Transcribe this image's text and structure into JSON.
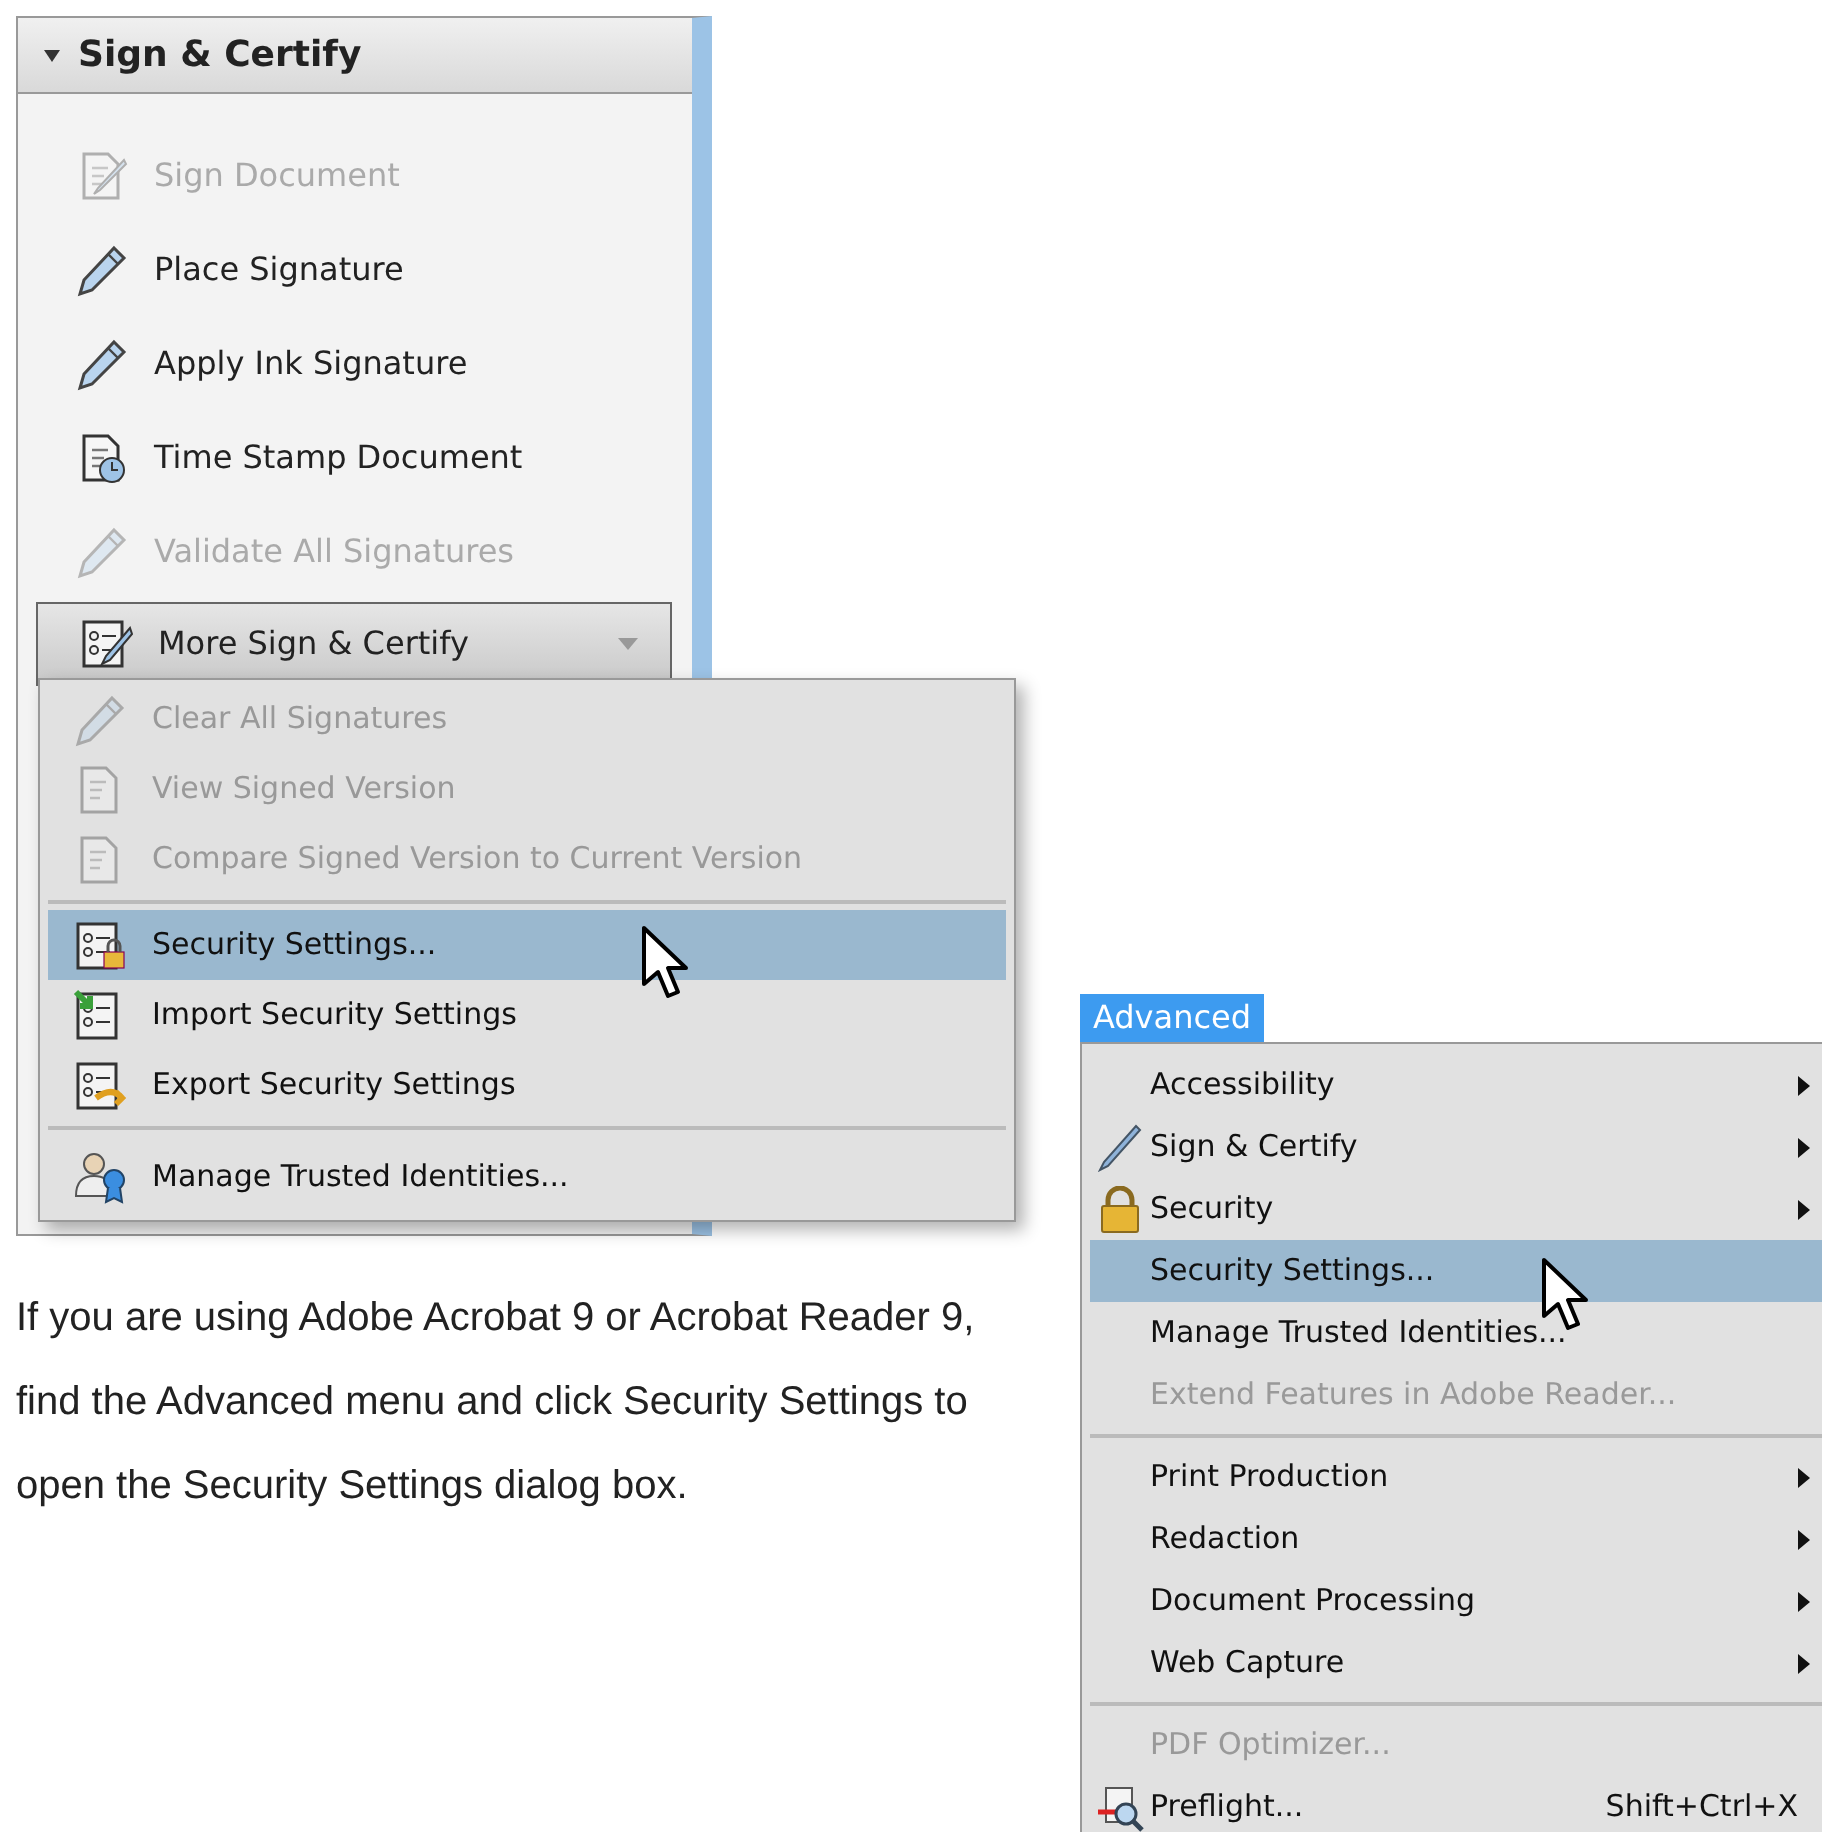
{
  "task_pane": {
    "title": "Sign & Certify",
    "expanded": true,
    "items": [
      {
        "label": "Sign Document",
        "disabled": true
      },
      {
        "label": "Place Signature",
        "disabled": false
      },
      {
        "label": "Apply Ink Signature",
        "disabled": false
      },
      {
        "label": "Time Stamp Document",
        "disabled": false
      },
      {
        "label": "Validate All Signatures",
        "disabled": true
      }
    ],
    "more_button": {
      "label": "More Sign & Certify"
    }
  },
  "more_menu": {
    "groups": [
      [
        {
          "label": "Clear All Signatures",
          "disabled": true,
          "selected": false
        },
        {
          "label": "View Signed Version",
          "disabled": true,
          "selected": false
        },
        {
          "label": "Compare Signed Version to Current Version",
          "disabled": true,
          "selected": false
        }
      ],
      [
        {
          "label": "Security Settings...",
          "disabled": false,
          "selected": true
        },
        {
          "label": "Import Security Settings",
          "disabled": false,
          "selected": false
        },
        {
          "label": "Export Security Settings",
          "disabled": false,
          "selected": false
        }
      ],
      [
        {
          "label": "Manage Trusted Identities...",
          "disabled": false,
          "selected": false
        }
      ]
    ]
  },
  "instructions": "If you are using Adobe Acrobat 9 or Acrobat Reader 9, find the Advanced menu and click Security Settings to open the Security Settings dialog box.",
  "advanced_menu": {
    "title": "Advanced",
    "groups": [
      [
        {
          "label": "Accessibility",
          "submenu": true,
          "disabled": false,
          "selected": false
        },
        {
          "label": "Sign & Certify",
          "submenu": true,
          "disabled": false,
          "selected": false
        },
        {
          "label": "Security",
          "submenu": true,
          "disabled": false,
          "selected": false
        },
        {
          "label": "Security Settings...",
          "submenu": false,
          "disabled": false,
          "selected": true
        },
        {
          "label": "Manage Trusted Identities...",
          "submenu": false,
          "disabled": false,
          "selected": false
        },
        {
          "label": "Extend Features in Adobe Reader...",
          "submenu": false,
          "disabled": true,
          "selected": false
        }
      ],
      [
        {
          "label": "Print Production",
          "submenu": true,
          "disabled": false,
          "selected": false
        },
        {
          "label": "Redaction",
          "submenu": true,
          "disabled": false,
          "selected": false
        },
        {
          "label": "Document Processing",
          "submenu": true,
          "disabled": false,
          "selected": false
        },
        {
          "label": "Web Capture",
          "submenu": true,
          "disabled": false,
          "selected": false
        }
      ],
      [
        {
          "label": "PDF Optimizer...",
          "submenu": false,
          "disabled": true,
          "selected": false
        },
        {
          "label": "Preflight...",
          "submenu": false,
          "disabled": false,
          "selected": false,
          "shortcut": "Shift+Ctrl+X"
        }
      ]
    ]
  }
}
